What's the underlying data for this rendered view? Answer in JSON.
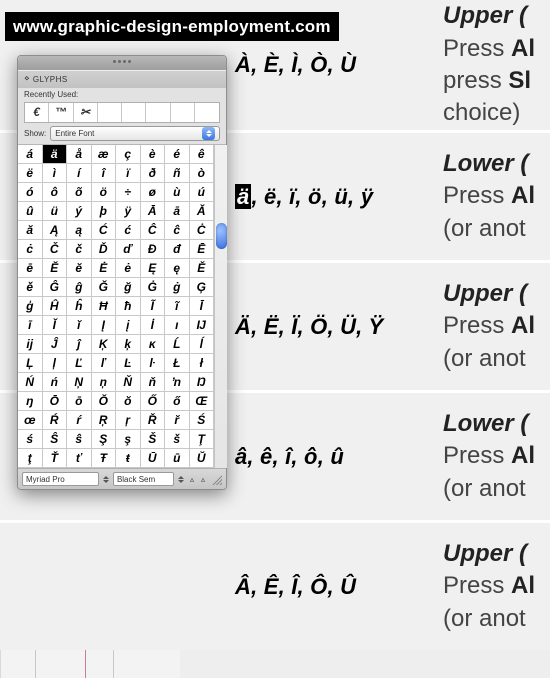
{
  "banner": {
    "url": "www.graphic-design-employment.com"
  },
  "rows": [
    {
      "chars": "À, È, Ì, Ò, Ù",
      "title": "Upper (",
      "line2a": "Press ",
      "line2b": "Al",
      "line3a": "press ",
      "line3b": "Sl",
      "line4": "choice)"
    },
    {
      "chars_hl": "ä",
      "chars_rest": ", ë, ï, ö, ü, ÿ",
      "title": "Lower (",
      "line2a": "Press ",
      "line2b": "Al",
      "line3": "(or anot"
    },
    {
      "chars": "Ä, Ë, Ï, Ö, Ü, Ÿ",
      "title": "Upper (",
      "line2a": "Press ",
      "line2b": "Al",
      "line3": "(or anot"
    },
    {
      "chars": "â, ê, î, ô, û",
      "title": "Lower (",
      "line2a": "Press ",
      "line2b": "Al",
      "line3": "(or anot"
    },
    {
      "chars": "Â, Ê, Î, Ô, Û",
      "title": "Upper (",
      "line2a": "Press ",
      "line2b": "Al",
      "line3": "(or anot"
    }
  ],
  "panel": {
    "title": "GLYPHS",
    "recently_used_label": "Recently Used:",
    "recent": [
      "€",
      "™",
      "✂",
      "",
      "",
      "",
      "",
      ""
    ],
    "show_label": "Show:",
    "show_value": "Entire Font",
    "footer_font": "Myriad Pro",
    "footer_style": "Black Sem",
    "selected_glyph": "ä",
    "glyphs": [
      "á",
      "ä",
      "å",
      "æ",
      "ç",
      "è",
      "é",
      "ê",
      "ë",
      "ì",
      "í",
      "î",
      "ï",
      "ð",
      "ñ",
      "ò",
      "ó",
      "ô",
      "õ",
      "ö",
      "÷",
      "ø",
      "ù",
      "ú",
      "û",
      "ü",
      "ý",
      "þ",
      "ÿ",
      "Ā",
      "ā",
      "Ă",
      "ă",
      "Ą",
      "ą",
      "Ć",
      "ć",
      "Ĉ",
      "ĉ",
      "Ċ",
      "ċ",
      "Č",
      "č",
      "Ď",
      "ď",
      "Đ",
      "đ",
      "Ē",
      "ē",
      "Ĕ",
      "ĕ",
      "Ė",
      "ė",
      "Ę",
      "ę",
      "Ě",
      "ě",
      "Ĝ",
      "ĝ",
      "Ğ",
      "ğ",
      "Ġ",
      "ġ",
      "Ģ",
      "ģ",
      "Ĥ",
      "ĥ",
      "Ħ",
      "ħ",
      "Ĩ",
      "ĩ",
      "Ī",
      "ī",
      "Ĭ",
      "ĭ",
      "Į",
      "į",
      "İ",
      "ı",
      "Ĳ",
      "ĳ",
      "Ĵ",
      "ĵ",
      "Ķ",
      "ķ",
      "ĸ",
      "Ĺ",
      "ĺ",
      "Ļ",
      "ļ",
      "Ľ",
      "ľ",
      "Ŀ",
      "ŀ",
      "Ł",
      "ł",
      "Ń",
      "ń",
      "Ņ",
      "ņ",
      "Ň",
      "ň",
      "ŉ",
      "Ŋ",
      "ŋ",
      "Ō",
      "ō",
      "Ŏ",
      "ŏ",
      "Ő",
      "ő",
      "Œ",
      "œ",
      "Ŕ",
      "ŕ",
      "Ŗ",
      "ŗ",
      "Ř",
      "ř",
      "Ś",
      "ś",
      "Ŝ",
      "ŝ",
      "Ş",
      "ş",
      "Š",
      "š",
      "Ţ",
      "ţ",
      "Ť",
      "ť",
      "Ŧ",
      "ŧ",
      "Ū",
      "ū",
      "Ŭ"
    ]
  }
}
